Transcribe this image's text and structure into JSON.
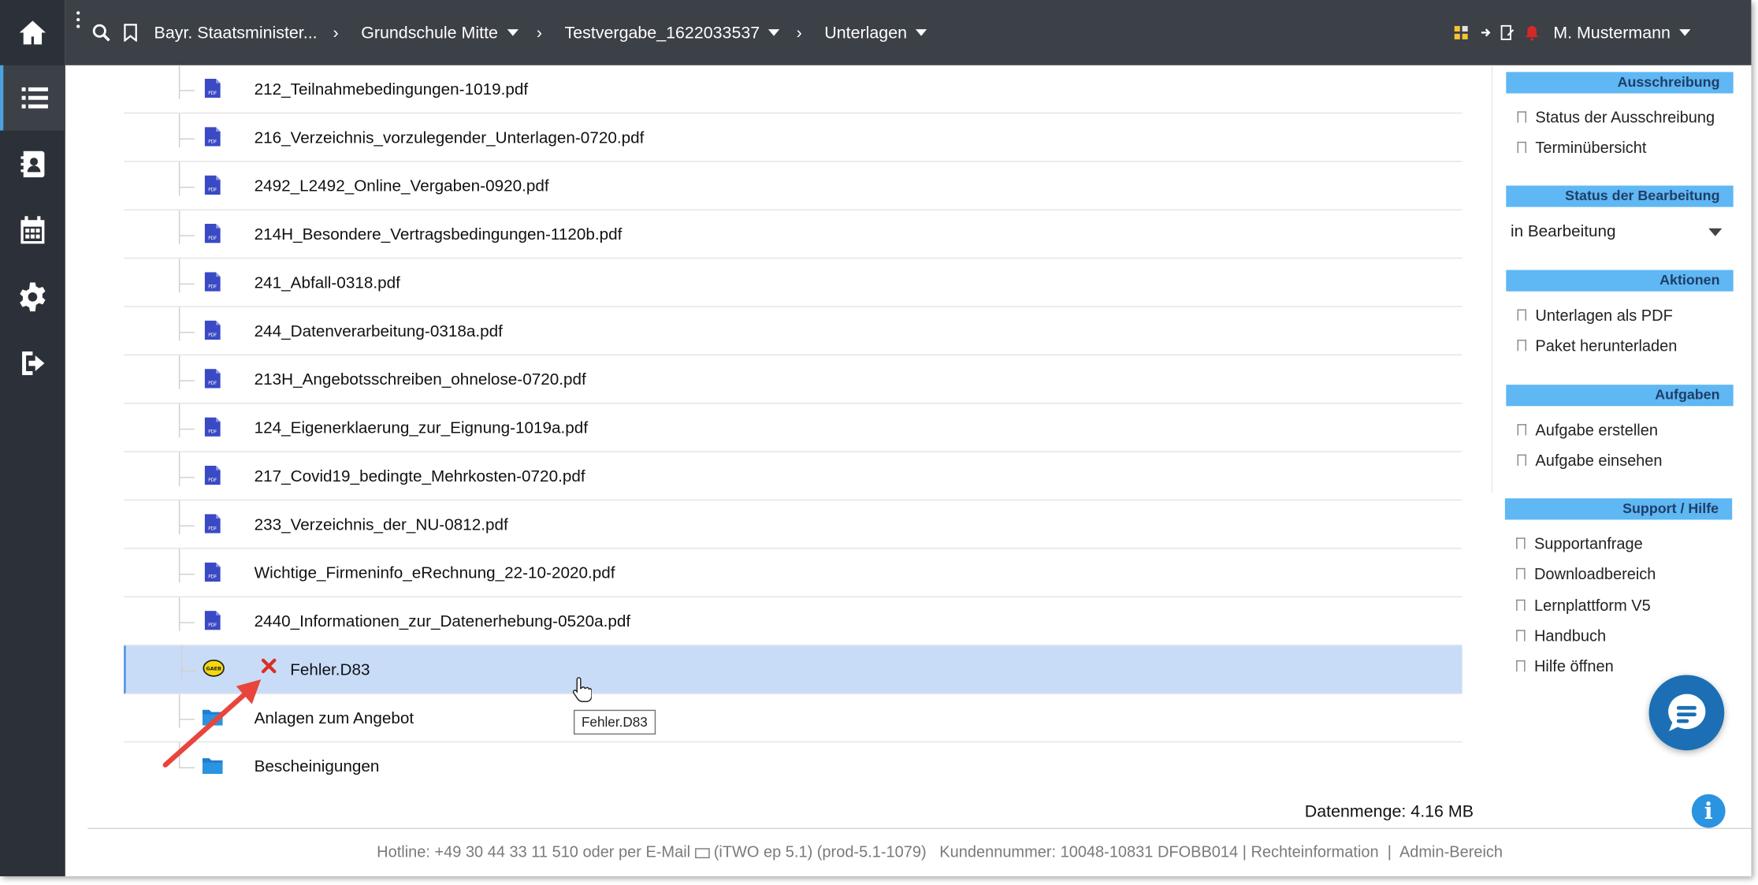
{
  "topbar": {
    "breadcrumbs": [
      {
        "label": "Bayr. Staatsminister...",
        "has_caret": false
      },
      {
        "label": "Grundschule Mitte",
        "has_caret": true
      },
      {
        "label": "Testvergabe_1622033537",
        "has_caret": true
      },
      {
        "label": "Unterlagen",
        "has_caret": true
      }
    ],
    "user_name": "M. Mustermann",
    "icons": [
      "search-icon",
      "bookmark-icon",
      "apps-icon",
      "arrow-icon",
      "edit-icon",
      "notification-icon"
    ]
  },
  "sidebar": {
    "items": [
      {
        "name": "home-icon"
      },
      {
        "name": "list-icon",
        "active": true
      },
      {
        "name": "contacts-icon"
      },
      {
        "name": "calendar-icon"
      },
      {
        "name": "settings-icon"
      },
      {
        "name": "logout-icon"
      }
    ]
  },
  "files": [
    {
      "label": "212_Teilnahmebedingungen-1019.pdf",
      "type": "pdf"
    },
    {
      "label": "216_Verzeichnis_vorzulegender_Unterlagen-0720.pdf",
      "type": "pdf"
    },
    {
      "label": "2492_L2492_Online_Vergaben-0920.pdf",
      "type": "pdf"
    },
    {
      "label": "214H_Besondere_Vertragsbedingungen-1120b.pdf",
      "type": "pdf"
    },
    {
      "label": "241_Abfall-0318.pdf",
      "type": "pdf"
    },
    {
      "label": "244_Datenverarbeitung-0318a.pdf",
      "type": "pdf"
    },
    {
      "label": "213H_Angebotsschreiben_ohnelose-0720.pdf",
      "type": "pdf"
    },
    {
      "label": "124_Eigenerklaerung_zur_Eignung-1019a.pdf",
      "type": "pdf"
    },
    {
      "label": "217_Covid19_bedingte_Mehrkosten-0720.pdf",
      "type": "pdf"
    },
    {
      "label": "233_Verzeichnis_der_NU-0812.pdf",
      "type": "pdf"
    },
    {
      "label": "Wichtige_Firmeninfo_eRechnung_22-10-2020.pdf",
      "type": "pdf"
    },
    {
      "label": "2440_Informationen_zur_Datenerhebung-0520a.pdf",
      "type": "pdf"
    },
    {
      "label": "Fehler.D83",
      "type": "gaeb-error",
      "icon_text": "GAEB"
    },
    {
      "label": "Anlagen zum Angebot",
      "type": "folder"
    },
    {
      "label": "Bescheinigungen",
      "type": "folder"
    }
  ],
  "tooltip": "Fehler.D83",
  "right_panel": {
    "ausschreibung": {
      "title": "Ausschreibung",
      "items": [
        "Status der Ausschreibung",
        "Terminübersicht"
      ]
    },
    "status": {
      "title": "Status der Bearbeitung",
      "value": "in Bearbeitung"
    },
    "aktionen": {
      "title": "Aktionen",
      "items": [
        "Unterlagen als PDF",
        "Paket herunterladen"
      ]
    },
    "aufgaben": {
      "title": "Aufgaben",
      "items": [
        "Aufgabe erstellen",
        "Aufgabe einsehen"
      ]
    },
    "support": {
      "title": "Support / Hilfe",
      "items": [
        "Supportanfrage",
        "Downloadbereich",
        "Lernplattform V5",
        "Handbuch",
        "Hilfe öffnen"
      ]
    }
  },
  "datenmenge": "Datenmenge: 4.16 MB",
  "footer": {
    "hotline": "Hotline: +49 30 44 33 11 510 oder per E-Mail",
    "version": "(iTWO ep 5.1) (prod-5.1-1079)",
    "kundennummer": "Kundennummer: 10048-10831 DFOBB014",
    "rechte": "Rechteinformation",
    "admin": "Admin-Bereich"
  },
  "colors": {
    "topbar": "#3c4047",
    "sidebar": "#2c3038",
    "panel_header": "#5fb7f4",
    "selected_row": "#c8dcf8",
    "pdf_icon": "#3a49c4",
    "folder_icon": "#1e7fd0",
    "error_x": "#d93025",
    "annotation_arrow": "#e8453c",
    "chat_fab": "#1c6fb4"
  }
}
